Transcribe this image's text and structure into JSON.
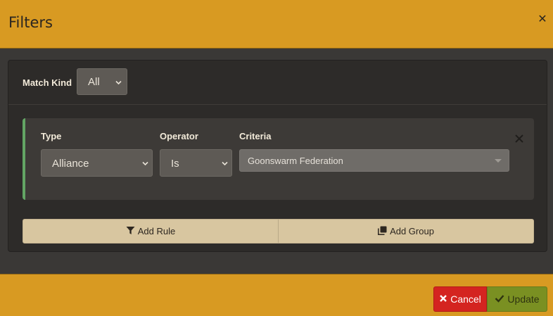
{
  "modal": {
    "title": "Filters",
    "close_icon": "close-icon"
  },
  "match": {
    "label": "Match Kind",
    "value": "All"
  },
  "rule": {
    "type_label": "Type",
    "type_value": "Alliance",
    "operator_label": "Operator",
    "operator_value": "Is",
    "criteria_label": "Criteria",
    "criteria_value": "Goonswarm Federation",
    "accent_color": "#63a564"
  },
  "actions": {
    "add_rule": "Add Rule",
    "add_group": "Add Group"
  },
  "footer": {
    "cancel": "Cancel",
    "update": "Update"
  },
  "colors": {
    "header": "#d89a22",
    "cancel": "#d42420",
    "update": "#7a9022"
  }
}
